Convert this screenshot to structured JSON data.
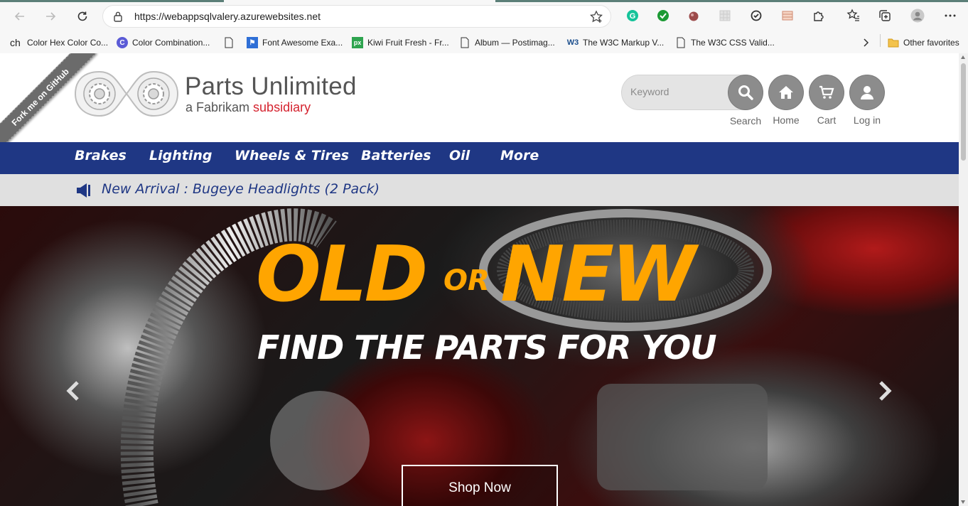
{
  "browser": {
    "url": "https://webappsqlvalery.azurewebsites.net",
    "bookmarks": [
      {
        "label": "ch",
        "icon": "text-ch-icon"
      },
      {
        "label": "Color Hex Color Co...",
        "icon": "colorhex-icon"
      },
      {
        "label": "Color Combination...",
        "icon": "color-c-icon"
      },
      {
        "label": "",
        "icon": "page-icon"
      },
      {
        "label": "Font Awesome Exa...",
        "icon": "flag-icon"
      },
      {
        "label": "Kiwi Fruit Fresh - Fr...",
        "icon": "px-icon"
      },
      {
        "label": "Album — Postimag...",
        "icon": "page-icon"
      },
      {
        "label": "The W3C Markup V...",
        "icon": "w3c-icon"
      },
      {
        "label": "The W3C CSS Valid...",
        "icon": "page-icon"
      }
    ],
    "other_favorites": "Other favorites"
  },
  "ribbon": {
    "label": "Fork me on GitHub"
  },
  "brand": {
    "name": "Parts Unlimited",
    "sub_prefix": "a Fabrikam",
    "sub_accent": "subsidiary"
  },
  "header": {
    "search_placeholder": "Keyword",
    "search_label": "Search",
    "home_label": "Home",
    "cart_label": "Cart",
    "login_label": "Log in"
  },
  "categories": [
    "Brakes",
    "Lighting",
    "Wheels & Tires",
    "Batteries",
    "Oil",
    "More"
  ],
  "announcement": "New Arrival : Bugeye Headlights (2 Pack)",
  "hero": {
    "word_old": "OLD",
    "word_or": "OR",
    "word_new": "NEW",
    "tagline": "FIND THE PARTS FOR YOU",
    "button": "Shop Now"
  },
  "colors": {
    "nav_bg": "#1f3784",
    "accent_orange": "#ffa500",
    "brand_red": "#d5232f"
  }
}
